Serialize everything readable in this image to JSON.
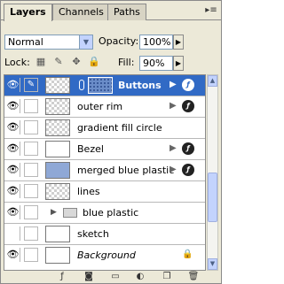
{
  "tabs": [
    {
      "label": "Layers",
      "active": true
    },
    {
      "label": "Channels",
      "active": false
    },
    {
      "label": "Paths",
      "active": false
    }
  ],
  "blend_mode": "Normal",
  "opacity": {
    "label": "Opacity:",
    "value": "100%"
  },
  "lock": {
    "label": "Lock:"
  },
  "fill": {
    "label": "Fill:",
    "value": "90%"
  },
  "layers": [
    {
      "name": "Buttons",
      "selected": true,
      "has_fx": true,
      "has_mask": true
    },
    {
      "name": "outer rim",
      "has_fx": true
    },
    {
      "name": "gradient fill circle",
      "has_fx": false
    },
    {
      "name": "Bezel",
      "has_fx": true
    },
    {
      "name": "merged blue plastic",
      "has_fx": true
    },
    {
      "name": "lines",
      "has_fx": false
    },
    {
      "name": "blue plastic",
      "is_folder": true
    },
    {
      "name": "sketch",
      "has_fx": false
    },
    {
      "name": "Background",
      "locked": true
    }
  ],
  "icons": {
    "eye": "eye-icon",
    "fx": "layer-style-icon",
    "lock": "lock-icon"
  },
  "colors": {
    "selection": "#316ac5",
    "panel_bg": "#ece9d8"
  }
}
